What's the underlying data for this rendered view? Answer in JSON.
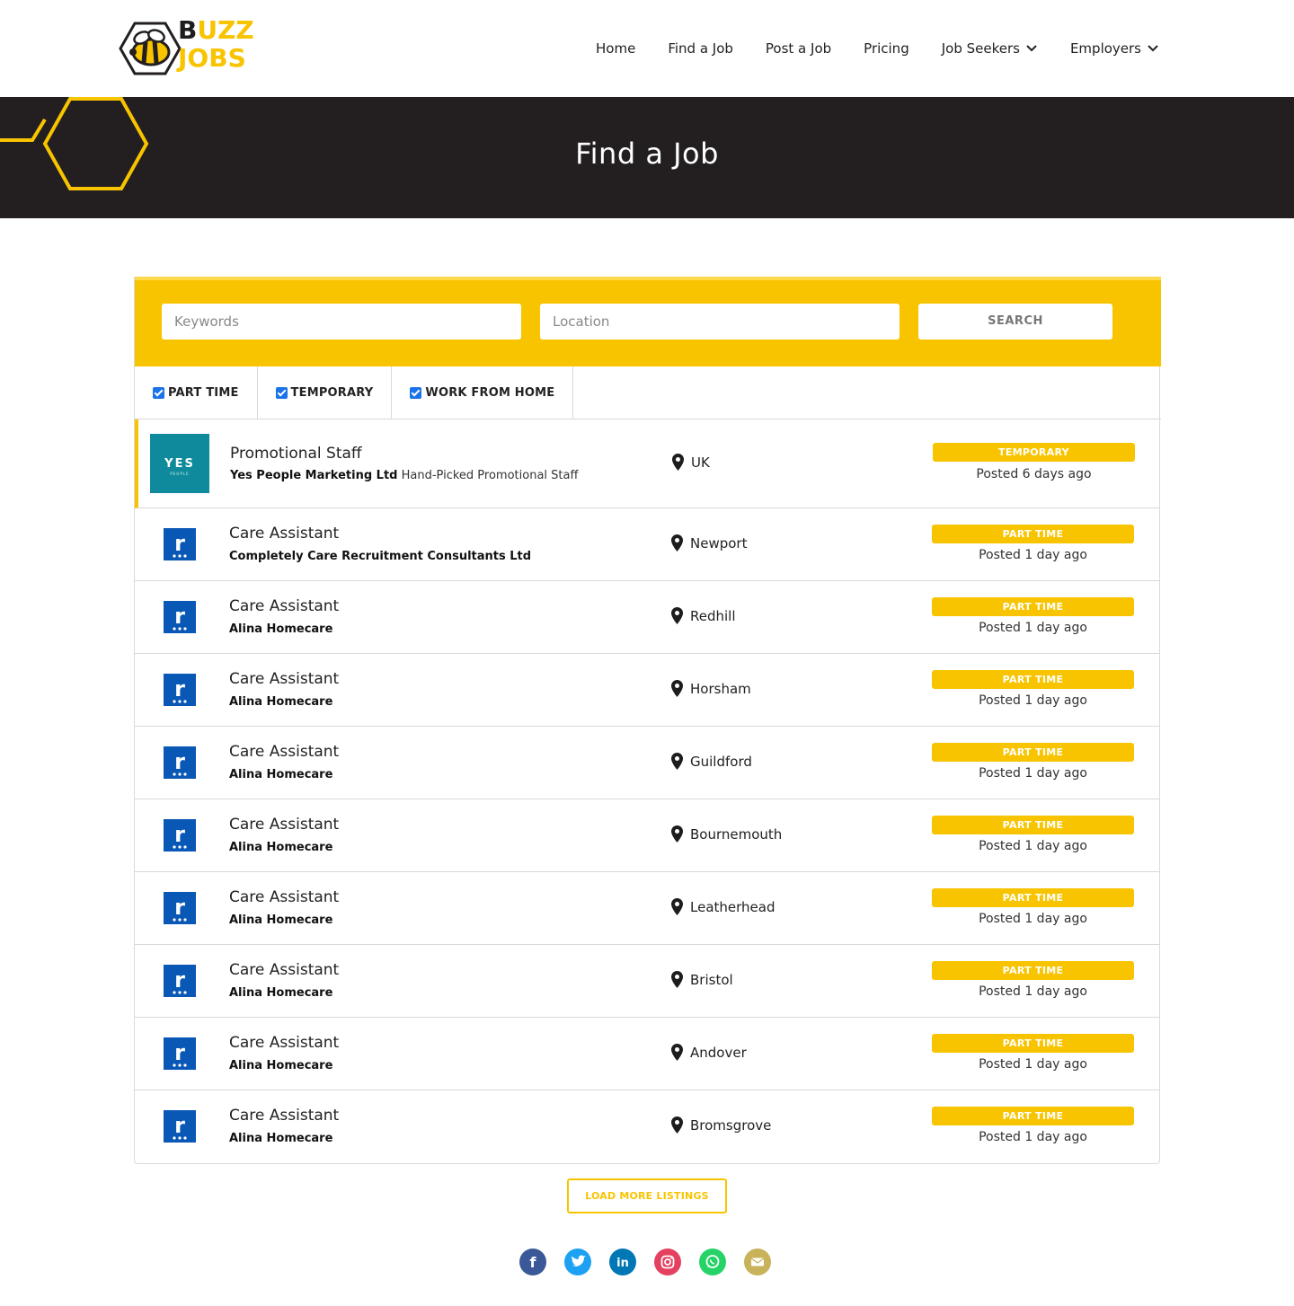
{
  "brand": {
    "line1_b": "B",
    "line1_zz": "UZZ",
    "line2": "JOBS",
    "yellow": "#f8c400",
    "dark": "#231f20"
  },
  "nav": {
    "items": [
      {
        "label": "Home"
      },
      {
        "label": "Find a Job"
      },
      {
        "label": "Post a Job"
      },
      {
        "label": "Pricing"
      },
      {
        "label": "Job Seekers",
        "dropdown": true
      },
      {
        "label": "Employers",
        "dropdown": true
      }
    ]
  },
  "hero": {
    "title": "Find a Job"
  },
  "search": {
    "keywords_placeholder": "Keywords",
    "location_placeholder": "Location",
    "button_label": "SEARCH"
  },
  "filters": [
    {
      "label": "PART TIME",
      "checked": true
    },
    {
      "label": "TEMPORARY",
      "checked": true
    },
    {
      "label": "WORK FROM HOME",
      "checked": true
    }
  ],
  "jobs": [
    {
      "title": "Promotional Staff",
      "company": "Yes People Marketing Ltd",
      "tagline": "Hand-Picked Promotional Staff",
      "location": "UK",
      "type": "TEMPORARY",
      "posted": "Posted 6 days ago",
      "logo": "yes-people-logo",
      "logo_text": "YES",
      "logo_subtext": "PEOPLE"
    },
    {
      "title": "Care Assistant",
      "company": "Completely Care Recruitment Consultants Ltd",
      "tagline": "",
      "location": "Newport",
      "type": "PART TIME",
      "posted": "Posted 1 day ago",
      "logo": "r-logo",
      "logo_text": "r"
    },
    {
      "title": "Care Assistant",
      "company": "Alina Homecare",
      "tagline": "",
      "location": "Redhill",
      "type": "PART TIME",
      "posted": "Posted 1 day ago",
      "logo": "r-logo",
      "logo_text": "r"
    },
    {
      "title": "Care Assistant",
      "company": "Alina Homecare",
      "tagline": "",
      "location": "Horsham",
      "type": "PART TIME",
      "posted": "Posted 1 day ago",
      "logo": "r-logo",
      "logo_text": "r"
    },
    {
      "title": "Care Assistant",
      "company": "Alina Homecare",
      "tagline": "",
      "location": "Guildford",
      "type": "PART TIME",
      "posted": "Posted 1 day ago",
      "logo": "r-logo",
      "logo_text": "r"
    },
    {
      "title": "Care Assistant",
      "company": "Alina Homecare",
      "tagline": "",
      "location": "Bournemouth",
      "type": "PART TIME",
      "posted": "Posted 1 day ago",
      "logo": "r-logo",
      "logo_text": "r"
    },
    {
      "title": "Care Assistant",
      "company": "Alina Homecare",
      "tagline": "",
      "location": "Leatherhead",
      "type": "PART TIME",
      "posted": "Posted 1 day ago",
      "logo": "r-logo",
      "logo_text": "r"
    },
    {
      "title": "Care Assistant",
      "company": "Alina Homecare",
      "tagline": "",
      "location": "Bristol",
      "type": "PART TIME",
      "posted": "Posted 1 day ago",
      "logo": "r-logo",
      "logo_text": "r"
    },
    {
      "title": "Care Assistant",
      "company": "Alina Homecare",
      "tagline": "",
      "location": "Andover",
      "type": "PART TIME",
      "posted": "Posted 1 day ago",
      "logo": "r-logo",
      "logo_text": "r"
    },
    {
      "title": "Care Assistant",
      "company": "Alina Homecare",
      "tagline": "",
      "location": "Bromsgrove",
      "type": "PART TIME",
      "posted": "Posted 1 day ago",
      "logo": "r-logo",
      "logo_text": "r"
    }
  ],
  "load_more": {
    "label": "LOAD MORE LISTINGS"
  },
  "social": [
    {
      "name": "facebook-icon",
      "color": "#3b5998",
      "glyph": "f"
    },
    {
      "name": "twitter-icon",
      "color": "#1da1f2",
      "glyph": ""
    },
    {
      "name": "linkedin-icon",
      "color": "#0077b5",
      "glyph": "in"
    },
    {
      "name": "instagram-icon",
      "color": "#e4405f",
      "glyph": ""
    },
    {
      "name": "whatsapp-icon",
      "color": "#25d366",
      "glyph": ""
    },
    {
      "name": "email-icon",
      "color": "#c9b35a",
      "glyph": ""
    }
  ]
}
